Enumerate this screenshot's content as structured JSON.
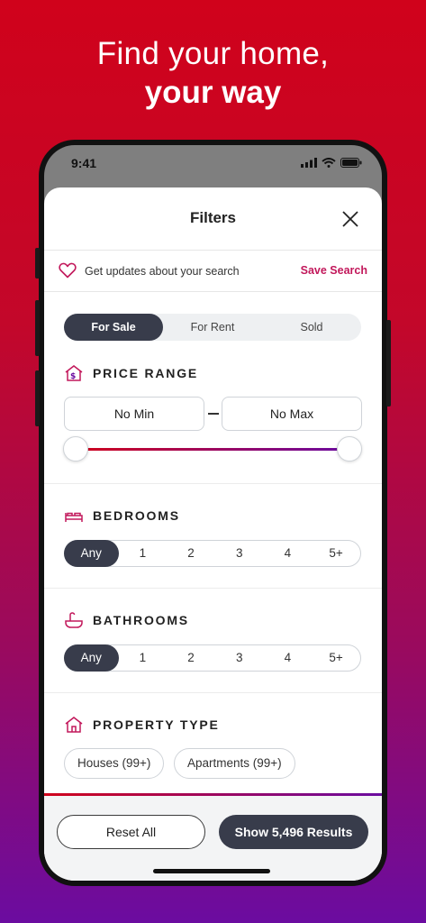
{
  "headline": {
    "line1": "Find your home,",
    "line2": "your way"
  },
  "status_bar": {
    "time": "9:41",
    "icons": [
      "signal-icon",
      "wifi-icon",
      "battery-icon"
    ]
  },
  "sheet": {
    "title": "Filters",
    "close_icon": "close-icon"
  },
  "updates": {
    "text": "Get updates about your search",
    "save_label": "Save Search",
    "icon": "heart-icon"
  },
  "listing_type": {
    "options": [
      "For Sale",
      "For Rent",
      "Sold"
    ],
    "selected": "For Sale"
  },
  "price_range": {
    "title": "PRICE RANGE",
    "min_label": "No Min",
    "max_label": "No Max",
    "icon": "price-house-icon"
  },
  "bedrooms": {
    "title": "BEDROOMS",
    "options": [
      "Any",
      "1",
      "2",
      "3",
      "4",
      "5+"
    ],
    "selected": "Any",
    "icon": "bed-icon"
  },
  "bathrooms": {
    "title": "BATHROOMS",
    "options": [
      "Any",
      "1",
      "2",
      "3",
      "4",
      "5+"
    ],
    "selected": "Any",
    "icon": "bathtub-icon"
  },
  "property_type": {
    "title": "PROPERTY TYPE",
    "chips": [
      "Houses (99+)",
      "Apartments (99+)"
    ],
    "icon": "house-icon"
  },
  "footer": {
    "reset_label": "Reset All",
    "show_label": "Show 5,496 Results"
  },
  "colors": {
    "brand_red": "#d0021b",
    "brand_purple": "#6b0ca0",
    "accent_pink": "#c2185b",
    "dark": "#383c4b"
  }
}
